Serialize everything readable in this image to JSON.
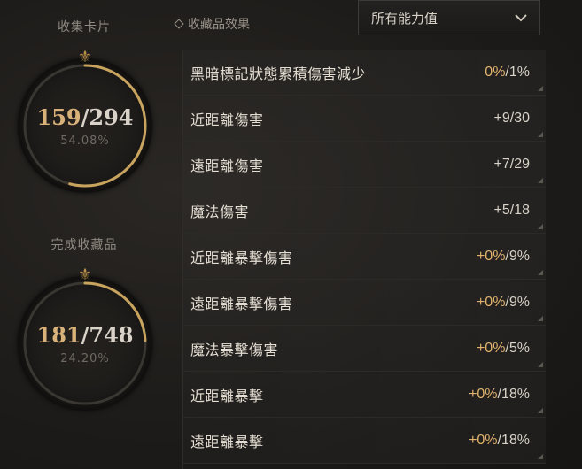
{
  "collection": {
    "cards_label": "收集卡片",
    "cards_current": "159",
    "cards_total": "294",
    "cards_percent": "54.08%",
    "cards_fraction": 0.5408,
    "items_label": "完成收藏品",
    "items_current": "181",
    "items_total": "748",
    "items_percent": "24.20%",
    "items_fraction": 0.242
  },
  "effects": {
    "title": "收藏品效果",
    "filter_value": "所有能力值",
    "rows": [
      {
        "label": "黑暗標記狀態累積傷害減少",
        "current": "0%",
        "max": "/1%"
      },
      {
        "label": "近距離傷害",
        "current": "+9",
        "max": "/30"
      },
      {
        "label": "遠距離傷害",
        "current": "+7",
        "max": "/29"
      },
      {
        "label": "魔法傷害",
        "current": "+5",
        "max": "/18"
      },
      {
        "label": "近距離暴擊傷害",
        "current": "+0%",
        "max": "/9%"
      },
      {
        "label": "遠距離暴擊傷害",
        "current": "+0%",
        "max": "/9%"
      },
      {
        "label": "魔法暴擊傷害",
        "current": "+0%",
        "max": "/5%"
      },
      {
        "label": "近距離暴擊",
        "current": "+0%",
        "max": "/18%"
      },
      {
        "label": "遠距離暴擊",
        "current": "+0%",
        "max": "/18%"
      }
    ]
  },
  "colors": {
    "accent": "#d9b27a",
    "ring_gold": "#c9a45e",
    "text": "#d8d2c8"
  }
}
